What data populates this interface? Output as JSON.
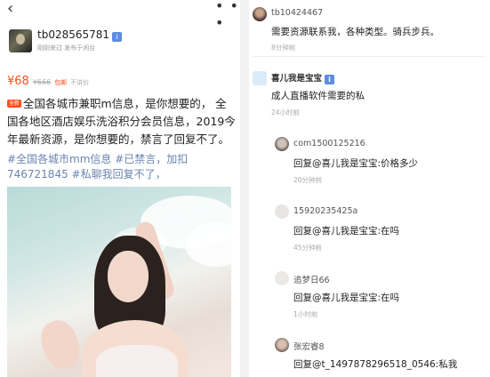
{
  "left": {
    "nav": {
      "back_icon": "‹",
      "more_icon": "• • •"
    },
    "seller": {
      "name": "tb028565781",
      "meta": "刚刚来过 发布于闲台"
    },
    "price": {
      "current": "¥68",
      "original": "¥666",
      "shipping": "包邮",
      "bargain": "不讲价"
    },
    "description": {
      "badge": "全新",
      "text": "全国各城市兼职m信息，是你想要的， 全国各地区酒店娱乐洗浴积分会员信息，2019今年最新资源，是你想要的，禁言了回复不了。"
    },
    "hashtags": "#全国各城市mm信息 #已禁言，加扣746721845 #私聊我回复不了，"
  },
  "right": {
    "comments": [
      {
        "user": "tb10424467",
        "text": "需要资源联系我，各种类型。骑兵步兵。",
        "time": "8分钟前"
      },
      {
        "user": "喜儿我是宝宝",
        "text": "成人直播软件需要的私",
        "time": "24小时前"
      },
      {
        "user": "com1500125216",
        "text": "回复@喜儿我是宝宝:价格多少",
        "time": "20分钟前"
      },
      {
        "user": "15920235425a",
        "text": "回复@喜儿我是宝宝:在吗",
        "time": "45分钟前"
      },
      {
        "user": "追梦日66",
        "text": "回复@喜儿我是宝宝:在吗",
        "time": "1小时前"
      },
      {
        "user": "张宏睿8",
        "text": "回复@t_1497878296518_0546:私我",
        "time": ""
      }
    ]
  },
  "colors": {
    "accent": "#ff4d1a",
    "hashtag": "#6a85b0",
    "vip": "#5c8de0"
  }
}
